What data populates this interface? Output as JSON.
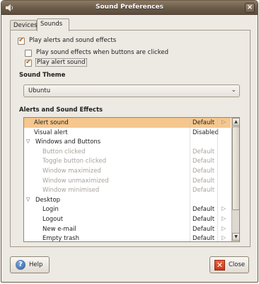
{
  "window": {
    "title": "Sound Preferences"
  },
  "tabs": [
    {
      "label": "Devices"
    },
    {
      "label": "Sounds"
    }
  ],
  "options": {
    "play_alerts": {
      "label": "Play alerts and sound effects",
      "checked": true
    },
    "play_button_sounds": {
      "label": "Play sound effects when buttons are clicked",
      "checked": false
    },
    "play_alert_sound": {
      "label": "Play alert sound",
      "checked": true
    }
  },
  "sound_theme": {
    "heading": "Sound Theme",
    "selected": "Ubuntu"
  },
  "alerts": {
    "heading": "Alerts and Sound Effects",
    "rows": [
      {
        "name": "Alert sound",
        "status": "Default",
        "indent": 1,
        "selected": true,
        "enabled": true,
        "play": true
      },
      {
        "name": "Visual alert",
        "status": "Disabled",
        "indent": 1,
        "selected": false,
        "enabled": true,
        "play": false
      },
      {
        "name": "Windows and Buttons",
        "status": "",
        "indent": 0,
        "expander": true,
        "enabled": true,
        "play": false
      },
      {
        "name": "Button clicked",
        "status": "Default",
        "indent": 2,
        "enabled": false,
        "play": false
      },
      {
        "name": "Toggle button clicked",
        "status": "Default",
        "indent": 2,
        "enabled": false,
        "play": false
      },
      {
        "name": "Window maximized",
        "status": "Default",
        "indent": 2,
        "enabled": false,
        "play": false
      },
      {
        "name": "Window unmaximized",
        "status": "Default",
        "indent": 2,
        "enabled": false,
        "play": false
      },
      {
        "name": "Window minimised",
        "status": "Default",
        "indent": 2,
        "enabled": false,
        "play": false
      },
      {
        "name": "Desktop",
        "status": "",
        "indent": 0,
        "expander": true,
        "enabled": true,
        "play": false
      },
      {
        "name": "Login",
        "status": "Default",
        "indent": 2,
        "enabled": true,
        "play": true
      },
      {
        "name": "Logout",
        "status": "Default",
        "indent": 2,
        "enabled": true,
        "play": true
      },
      {
        "name": "New e-mail",
        "status": "Default",
        "indent": 2,
        "enabled": true,
        "play": true
      },
      {
        "name": "Empty trash",
        "status": "Default",
        "indent": 2,
        "enabled": true,
        "play": true
      }
    ]
  },
  "buttons": {
    "help": "Help",
    "close": "Close"
  },
  "colors": {
    "titlebar": "#6a5a48",
    "selection": "#f5c78e",
    "check_mark": "#c06a16"
  }
}
